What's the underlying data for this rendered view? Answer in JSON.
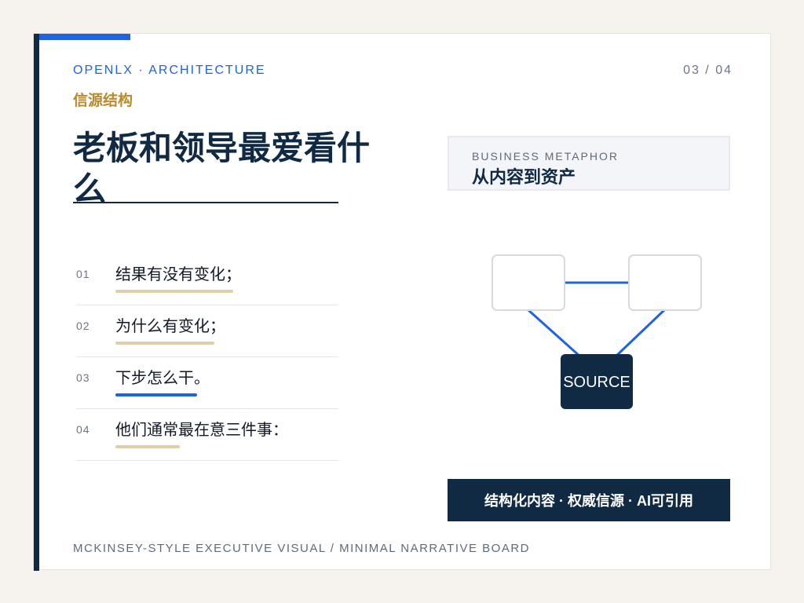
{
  "header": {
    "kicker": "OPENLX · ARCHITECTURE",
    "page_number": "03 / 04",
    "section": "信源结构"
  },
  "title": "老板和领导最爱看什么",
  "list": [
    {
      "number": "01",
      "text": "结果有没有变化；",
      "bar_fraction": 0.75,
      "bar_color": "#e0cfa6"
    },
    {
      "number": "02",
      "text": "为什么有变化；",
      "bar_fraction": 0.63,
      "bar_color": "#e0cfa6"
    },
    {
      "number": "03",
      "text": "下步怎么干。",
      "bar_fraction": 0.52,
      "bar_color": "#1f63e0"
    },
    {
      "number": "04",
      "text": "他们通常最在意三件事：",
      "bar_fraction": 0.41,
      "bar_color": "#e0cfa6"
    }
  ],
  "metaphor": {
    "label": "BUSINESS METAPHOR",
    "title": "从内容到资产"
  },
  "diagram": {
    "source_label": "SOURCE"
  },
  "footer_band": "结构化内容 · 权威信源 · AI可引用",
  "bottom_caption": "MCKINSEY-STYLE EXECUTIVE VISUAL / MINIMAL NARRATIVE BOARD",
  "colors": {
    "navy": "#102a44",
    "accent_blue": "#1f63e0",
    "gold": "#b98a2e",
    "tan_bar": "#e0cfa6"
  }
}
